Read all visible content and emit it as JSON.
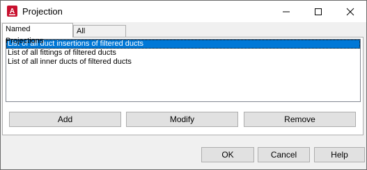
{
  "window": {
    "title": "Projection"
  },
  "tabs": [
    {
      "label": "Named Projections",
      "active": true
    },
    {
      "label": "All Projections",
      "active": false
    }
  ],
  "list": {
    "items": [
      {
        "label": "List of all duct insertions of filtered ducts",
        "selected": true
      },
      {
        "label": "List of all fittings of filtered ducts",
        "selected": false
      },
      {
        "label": "List of all inner ducts of filtered ducts",
        "selected": false
      }
    ]
  },
  "actions": {
    "add_label": "Add",
    "modify_label": "Modify",
    "remove_label": "Remove"
  },
  "footer": {
    "ok_label": "OK",
    "cancel_label": "Cancel",
    "help_label": "Help"
  },
  "colors": {
    "selection": "#0078d7",
    "app_icon": "#c8102e"
  }
}
